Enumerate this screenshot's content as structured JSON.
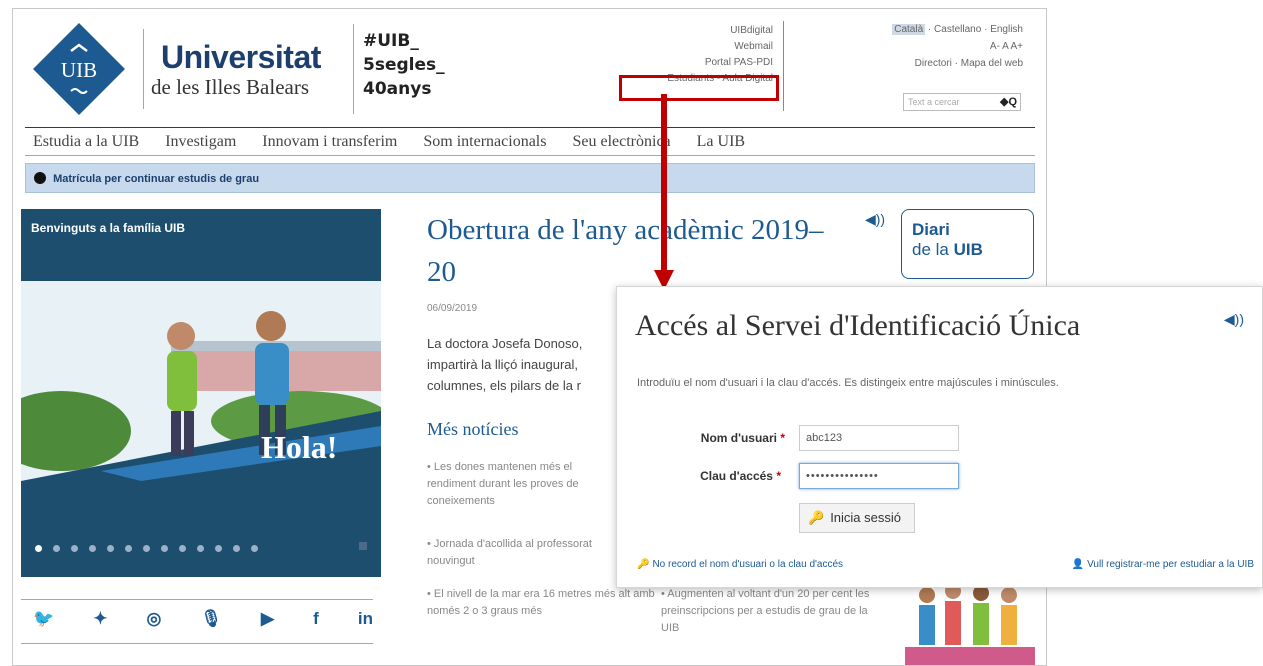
{
  "header": {
    "logo_text": "UIB",
    "university_name": "Universitat",
    "university_sub": "de les Illes Balears",
    "hashtag_lines": [
      "#UIB_",
      "5segles_",
      "40anys"
    ],
    "util_links": [
      "UIBdigital",
      "Webmail",
      "Portal PAS-PDI",
      "Estudiants - Aula Digital"
    ],
    "languages": [
      "Català",
      "Castellano",
      "English"
    ],
    "font_sizes": "A-  A  A+",
    "directory_links": "Directori · Mapa del web",
    "search_placeholder": "Text a cercar",
    "search_icon": "◆Q"
  },
  "nav": {
    "items": [
      "Estudia a la UIB",
      "Investigam",
      "Innovam i transferim",
      "Som internacionals",
      "Seu electrònica",
      "La UIB"
    ]
  },
  "notice": {
    "text": "Matrícula per continuar estudis de grau"
  },
  "hero": {
    "caption": "Benvinguts a la família UIB",
    "greeting": "Hola!",
    "dots": 13,
    "active_dot": 0
  },
  "social": {
    "icons": [
      "twitter-icon",
      "twitter-alt-icon",
      "instagram-icon",
      "podcast-icon",
      "youtube-icon",
      "facebook-icon",
      "linkedin-icon"
    ],
    "glyphs": [
      "🐦",
      "✦",
      "◎",
      "🎙",
      "▶",
      "f",
      "in"
    ]
  },
  "article": {
    "title": "Obertura de l'any acadèmic 2019–20",
    "date": "06/09/2019",
    "body": "La doctora Josefa Donoso, impartirà la lliçó inaugural, columnes, els pilars de la r",
    "more_news_heading": "Més notícies",
    "news": [
      "• Les dones mantenen més el rendiment durant les proves de coneixements",
      "• Jornada d'acollida al professorat nouvingut",
      "• El nivell de la mar era 16 metres més alt amb només 2 o 3 graus més",
      "• Augmenten al voltant d'un 20 per cent les preinscripcions per a estudis de grau de la UIB"
    ]
  },
  "diari": {
    "line1": "Diari",
    "line2_prefix": "de la ",
    "line2_bold": "UIB"
  },
  "login": {
    "title": "Accés al Servei d'Identificació Única",
    "intro": "Introduïu el nom d'usuari i la clau d'accés. Es distingeix entre majúscules i minúscules.",
    "user_label": "Nom d'usuari",
    "pass_label": "Clau d'accés",
    "required_mark": "*",
    "user_value": "abc123",
    "pass_value": "•••••••••••••••",
    "button_label": "Inicia sessió",
    "forgot_text": "No record el nom d'usuari o la clau d'accés",
    "register_text": "Vull registrar-me per estudiar a la UIB"
  },
  "colors": {
    "brand_blue": "#1d5a92",
    "highlight_red": "#c00000",
    "notice_bg": "#c7d9ec"
  }
}
